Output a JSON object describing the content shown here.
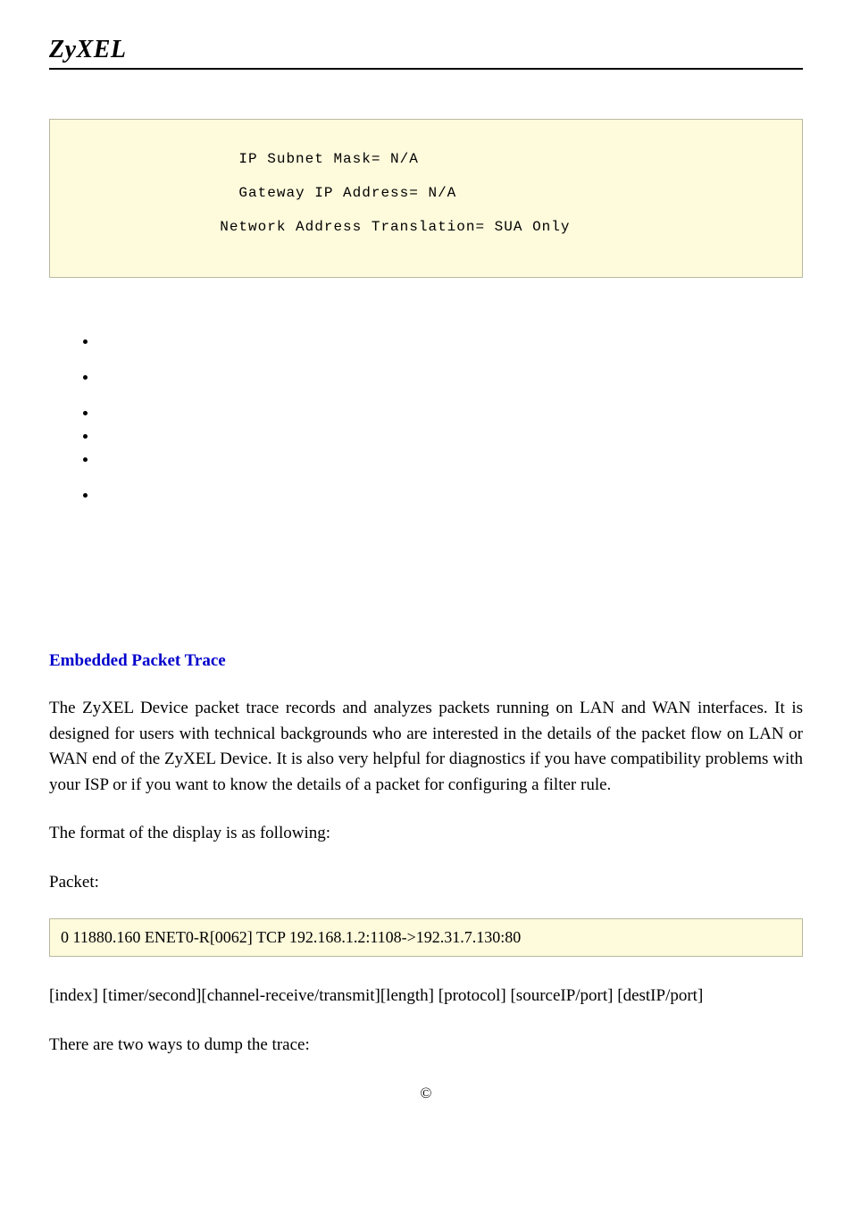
{
  "header": {
    "logo": "ZyXEL"
  },
  "config_box": {
    "line1": "                   IP Subnet Mask= N/A",
    "line2": "                   Gateway IP Address= N/A",
    "line3": "                 Network Address Translation= SUA Only"
  },
  "section": {
    "heading": "Embedded Packet Trace",
    "intro": "The ZyXEL Device packet trace records and analyzes packets running on LAN and WAN interfaces. It is designed for users with technical backgrounds who are interested in the details of the packet flow on LAN or WAN end of the ZyXEL Device. It is also very helpful for diagnostics if you have compatibility problems with your ISP or if you want to know the details of a packet for configuring a filter rule.",
    "format_lead": "The format of the display is as following:",
    "packet_label": "Packet:",
    "packet_sample": "0       11880.160 ENET0-R[0062] TCP 192.168.1.2:1108->192.31.7.130:80",
    "format_fields": "[index] [timer/second][channel-receive/transmit][length]  [protocol] [sourceIP/port] [destIP/port]",
    "dump_lead": "There are two ways to dump the trace:"
  },
  "footer": {
    "copyright": "©"
  }
}
